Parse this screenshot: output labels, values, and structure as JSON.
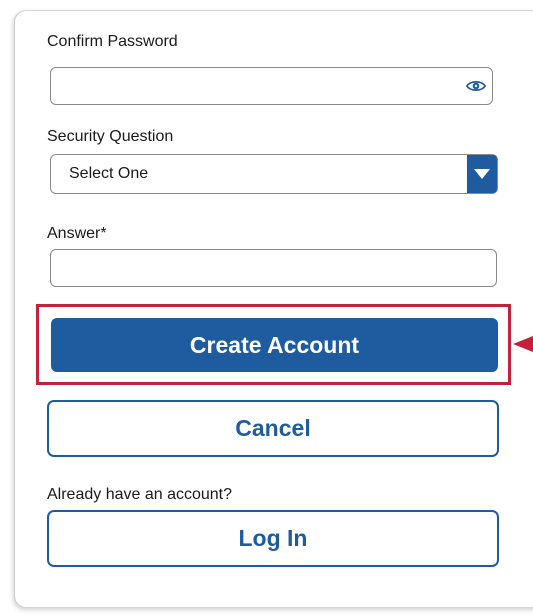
{
  "form": {
    "confirm_password": {
      "label": "Confirm Password",
      "value": "",
      "toggle_icon": "eye-icon"
    },
    "security_question": {
      "label": "Security Question",
      "selected": "Select One",
      "dropdown_icon": "chevron-down-icon"
    },
    "answer": {
      "label": "Answer*",
      "value": ""
    },
    "create_account_label": "Create Account",
    "cancel_label": "Cancel",
    "login_prompt": "Already have an account?",
    "login_label": "Log In"
  },
  "colors": {
    "primary": "#1f5c9f",
    "highlight": "#c4213a",
    "field_border": "#8a8a8a"
  }
}
